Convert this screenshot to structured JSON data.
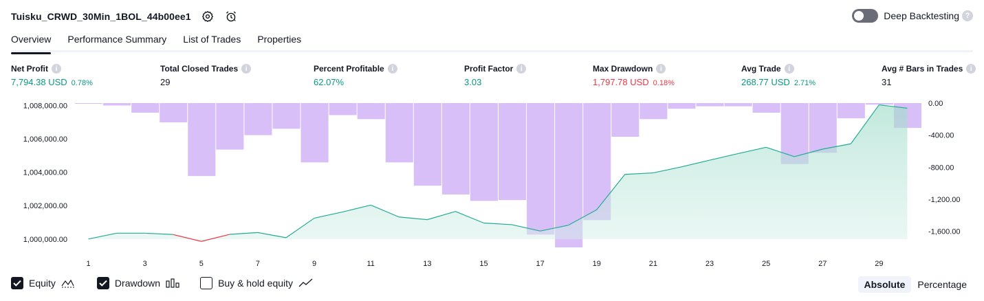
{
  "strategy": {
    "name": "Tuisku_CRWD_30Min_1BOL_44b00ee1"
  },
  "deep_backtesting": {
    "label": "Deep Backtesting",
    "enabled": false
  },
  "tabs": [
    {
      "label": "Overview",
      "active": true
    },
    {
      "label": "Performance Summary",
      "active": false
    },
    {
      "label": "List of Trades",
      "active": false
    },
    {
      "label": "Properties",
      "active": false
    }
  ],
  "metrics": [
    {
      "label": "Net Profit",
      "value": "7,794.38 USD",
      "pct": "0.78%",
      "color": "#089981"
    },
    {
      "label": "Total Closed Trades",
      "value": "29",
      "pct": "",
      "color": "#131722"
    },
    {
      "label": "Percent Profitable",
      "value": "62.07%",
      "pct": "",
      "color": "#089981"
    },
    {
      "label": "Profit Factor",
      "value": "3.03",
      "pct": "",
      "color": "#089981"
    },
    {
      "label": "Max Drawdown",
      "value": "1,797.78 USD",
      "pct": "0.18%",
      "color": "#f23645"
    },
    {
      "label": "Avg Trade",
      "value": "268.77 USD",
      "pct": "2.71%",
      "color": "#089981"
    },
    {
      "label": "Avg # Bars in Trades",
      "value": "31",
      "pct": "",
      "color": "#131722"
    }
  ],
  "legend": {
    "equity": {
      "label": "Equity",
      "checked": true
    },
    "drawdown": {
      "label": "Drawdown",
      "checked": true
    },
    "buy_hold": {
      "label": "Buy & hold equity",
      "checked": false
    }
  },
  "modes": {
    "absolute": "Absolute",
    "percentage": "Percentage",
    "selected": "Absolute"
  },
  "colors": {
    "equity_line": "#22ab94",
    "equity_fill": "#d4efe8",
    "drawdown_bar": "#d9bff8",
    "negative": "#f23645"
  },
  "chart_data": {
    "type": "bar+line",
    "x_ticks": [
      "1",
      "3",
      "5",
      "7",
      "9",
      "11",
      "13",
      "15",
      "17",
      "19",
      "21",
      "23",
      "25",
      "27",
      "29"
    ],
    "left_axis": {
      "ticks": [
        "1,008,000.00",
        "1,006,000.00",
        "1,004,000.00",
        "1,002,000.00",
        "1,000,000.00"
      ],
      "range": [
        999500,
        1008300
      ]
    },
    "right_axis": {
      "ticks": [
        "0.00",
        "-400.00",
        "-800.00",
        "-1,200.00",
        "-1,600.00"
      ],
      "range": [
        -1800,
        0
      ]
    },
    "series": [
      {
        "name": "Equity",
        "x": [
          1,
          2,
          3,
          4,
          5,
          6,
          7,
          8,
          9,
          10,
          11,
          12,
          13,
          14,
          15,
          16,
          17,
          18,
          19,
          20,
          21,
          22,
          23,
          24,
          25,
          26,
          27,
          28,
          29,
          30
        ],
        "values": [
          1000000,
          1000350,
          1000350,
          1000270,
          999860,
          1000280,
          1000390,
          1000080,
          1001250,
          1001620,
          1002030,
          1001320,
          1001160,
          1001650,
          1000960,
          1000860,
          1000480,
          1000830,
          1001750,
          1003870,
          1003960,
          1004320,
          1004720,
          1005110,
          1005490,
          1004930,
          1005380,
          1005700,
          1008030,
          1007830
        ]
      },
      {
        "name": "Drawdown",
        "x": [
          1,
          2,
          3,
          4,
          5,
          6,
          7,
          8,
          9,
          10,
          11,
          12,
          13,
          14,
          15,
          16,
          17,
          18,
          19,
          20,
          21,
          22,
          23,
          24,
          25,
          26,
          27,
          28,
          29,
          30
        ],
        "values": [
          0,
          -30,
          -120,
          -240,
          -910,
          -580,
          -400,
          -320,
          -740,
          -150,
          -200,
          -740,
          -1030,
          -1140,
          -1220,
          -1210,
          -1640,
          -1800,
          -1460,
          -420,
          -200,
          -70,
          -40,
          -40,
          -120,
          -760,
          -620,
          -190,
          -20,
          -310
        ]
      }
    ]
  }
}
